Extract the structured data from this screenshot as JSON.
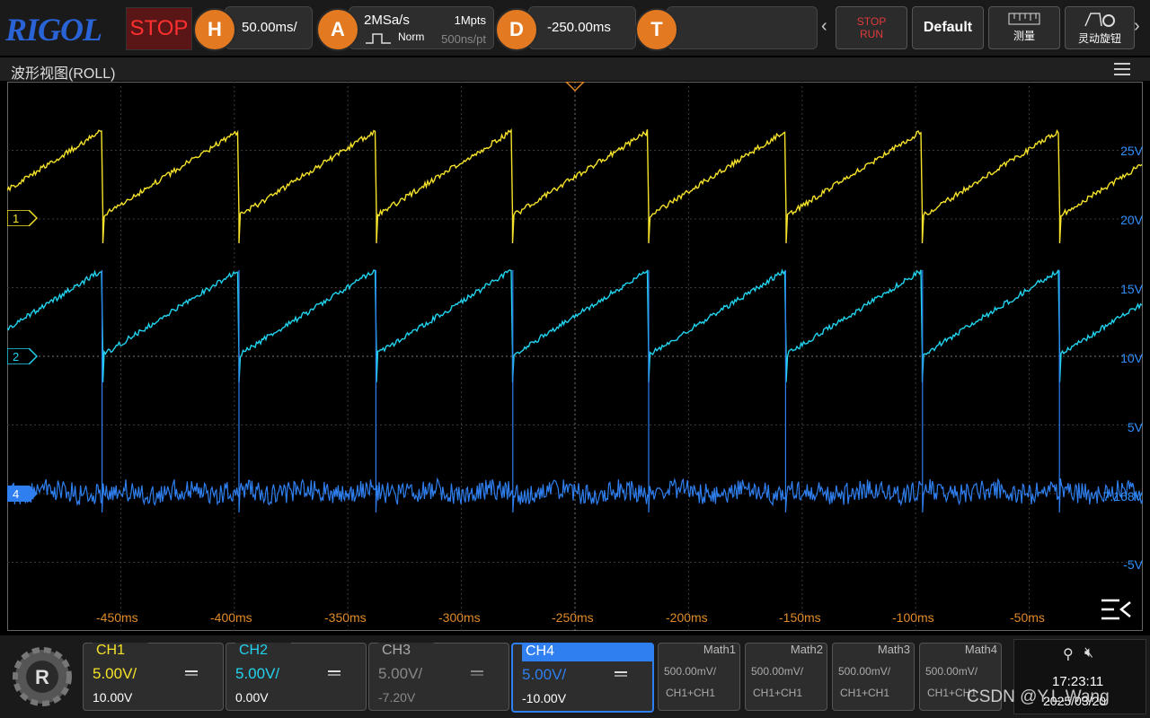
{
  "topbar": {
    "logo": "RIGOL",
    "run_state": "STOP",
    "horizontal": {
      "key": "H",
      "scale": "50.00ms/"
    },
    "acquire": {
      "key": "A",
      "rate": "2MSa/s",
      "depth": "1Mpts",
      "mode": "Norm",
      "pts": "500ns/pt"
    },
    "delay": {
      "key": "D",
      "value": "-250.00ms"
    },
    "trigger": {
      "key": "T"
    },
    "buttons": {
      "stop_label": "STOP",
      "run_label": "RUN",
      "default_label": "Default",
      "measure_label": "测量",
      "knob_label": "灵动旋钮"
    }
  },
  "window": {
    "title": "波形视图(ROLL)"
  },
  "x_ticks": [
    "-450ms",
    "-400ms",
    "-350ms",
    "-300ms",
    "-250ms",
    "-200ms",
    "-150ms",
    "-100ms",
    "-50ms"
  ],
  "y_ticks": [
    "25V",
    "20V",
    "15V",
    "10V",
    "5V",
    "-5V"
  ],
  "ch4_cursor_value": "7.168V",
  "markers": {
    "ch1": "1",
    "ch2": "2",
    "ch4": "4"
  },
  "channels": [
    {
      "name": "CH1",
      "scale": "5.00V/",
      "offset": "10.00V",
      "color": "#f5e22a"
    },
    {
      "name": "CH2",
      "scale": "5.00V/",
      "offset": "0.00V",
      "color": "#22d3ee"
    },
    {
      "name": "CH3",
      "scale": "5.00V/",
      "offset": "-7.20V",
      "color": "#9a9a9a"
    },
    {
      "name": "CH4",
      "scale": "5.00V/",
      "offset": "-10.00V",
      "color": "#2f7ff0"
    }
  ],
  "math": [
    {
      "name": "Math1",
      "scale": "500.00mV/",
      "source": "CH1+CH1"
    },
    {
      "name": "Math2",
      "scale": "500.00mV/",
      "source": "CH1+CH1"
    },
    {
      "name": "Math3",
      "scale": "500.00mV/",
      "source": "CH1+CH1"
    },
    {
      "name": "Math4",
      "scale": "500.00mV/",
      "source": "CH1+CH1"
    }
  ],
  "status": {
    "time": "17:23:11",
    "date": "2025/03/20"
  },
  "watermark": "CSDN @Y.L.Wang",
  "colors": {
    "ch1": "#f5e22a",
    "ch2": "#22d3ee",
    "ch4": "#2f7ff0",
    "time_axis": "#e08a2a",
    "volt_axis": "#2f8fff"
  }
}
